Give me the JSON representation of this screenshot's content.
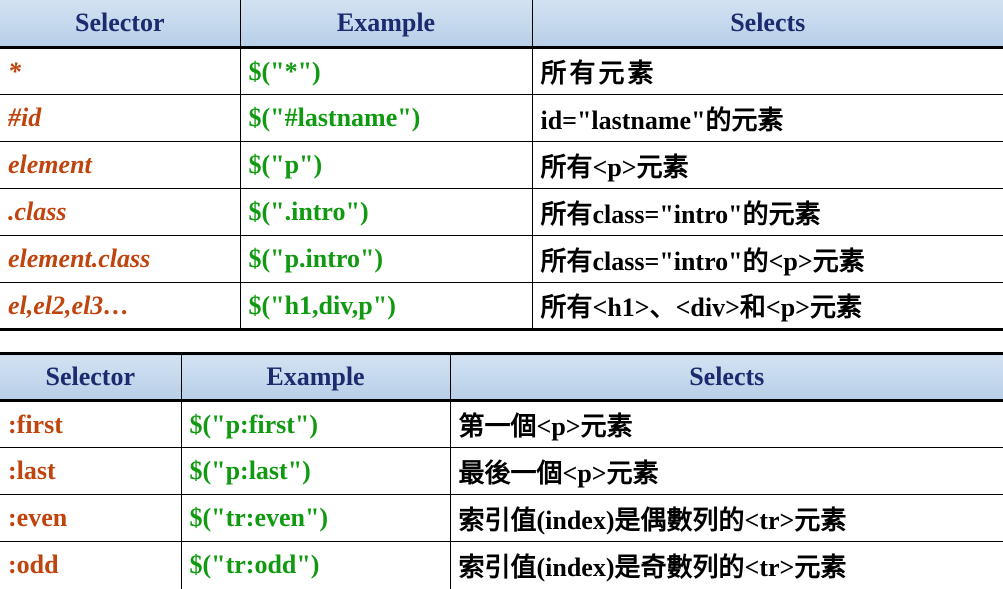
{
  "table1": {
    "headers": [
      "Selector",
      "Example",
      "Selects"
    ],
    "rows": [
      [
        "*",
        "$(\"*\")",
        "所有元素"
      ],
      [
        "#id",
        "$(\"#lastname\")",
        "id=\"lastname\"的元素"
      ],
      [
        "element",
        "$(\"p\")",
        "所有<p>元素"
      ],
      [
        ".class",
        "$(\".intro\")",
        "所有class=\"intro\"的元素"
      ],
      [
        "element.class",
        "$(\"p.intro\")",
        "所有class=\"intro\"的<p>元素"
      ],
      [
        "el,el2,el3…",
        "$(\"h1,div,p\")",
        "所有<h1>、<div>和<p>元素"
      ]
    ]
  },
  "table2": {
    "headers": [
      "Selector",
      "Example",
      "Selects"
    ],
    "rows": [
      [
        ":first",
        "$(\"p:first\")",
        "第一個<p>元素"
      ],
      [
        ":last",
        "$(\"p:last\")",
        "最後一個<p>元素"
      ],
      [
        ":even",
        "$(\"tr:even\")",
        "索引值(index)是偶數列的<tr>元素"
      ],
      [
        ":odd",
        "$(\"tr:odd\")",
        "索引值(index)是奇數列的<tr>元素"
      ]
    ]
  },
  "colors": {
    "header_text": "#1c2a6e",
    "header_bg": "#c7d9ee",
    "selector_text": "#c0440d",
    "example_text": "#119a11"
  }
}
